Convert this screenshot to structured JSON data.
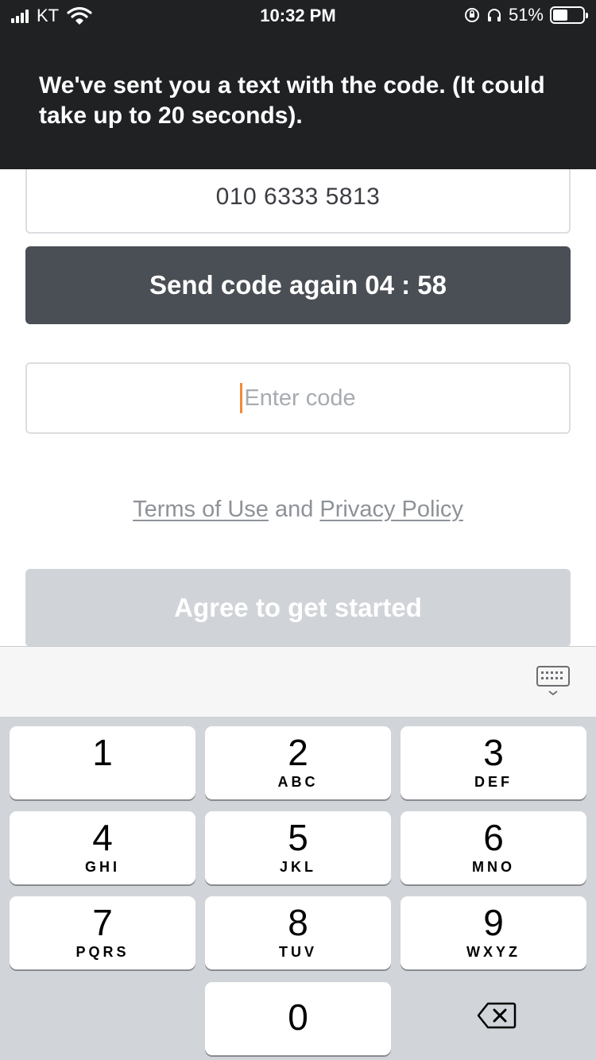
{
  "status_bar": {
    "carrier": "KT",
    "time": "10:32 PM",
    "battery_text": "51%",
    "battery_level": 0.51,
    "icons": [
      "signal-icon",
      "wifi-icon",
      "orientation-lock-icon",
      "headphones-icon",
      "battery-icon"
    ]
  },
  "toast": {
    "message": "We've sent you a text with the code. (It could take up to 20 seconds)."
  },
  "form": {
    "phone_number": "010 6333 5813",
    "resend_label": "Send code again",
    "resend_timer": "04 : 58",
    "code_placeholder": "Enter code",
    "terms_link": "Terms of Use",
    "terms_conjunction": "and",
    "privacy_link": "Privacy Policy",
    "agree_label": "Agree to get started"
  },
  "keyboard": {
    "dismiss_icon": "keyboard-dismiss-icon",
    "delete_icon": "backspace-icon",
    "keys": [
      {
        "digit": "1",
        "letters": ""
      },
      {
        "digit": "2",
        "letters": "ABC"
      },
      {
        "digit": "3",
        "letters": "DEF"
      },
      {
        "digit": "4",
        "letters": "GHI"
      },
      {
        "digit": "5",
        "letters": "JKL"
      },
      {
        "digit": "6",
        "letters": "MNO"
      },
      {
        "digit": "7",
        "letters": "PQRS"
      },
      {
        "digit": "8",
        "letters": "TUV"
      },
      {
        "digit": "9",
        "letters": "WXYZ"
      },
      {
        "digit": "0",
        "letters": ""
      }
    ]
  },
  "colors": {
    "toast_bg": "#1f2123",
    "resend_bg": "#4a4e55",
    "agree_disabled_bg": "#d0d4d8",
    "cursor": "#f2893a",
    "keypad_bg": "#d1d4d9"
  }
}
